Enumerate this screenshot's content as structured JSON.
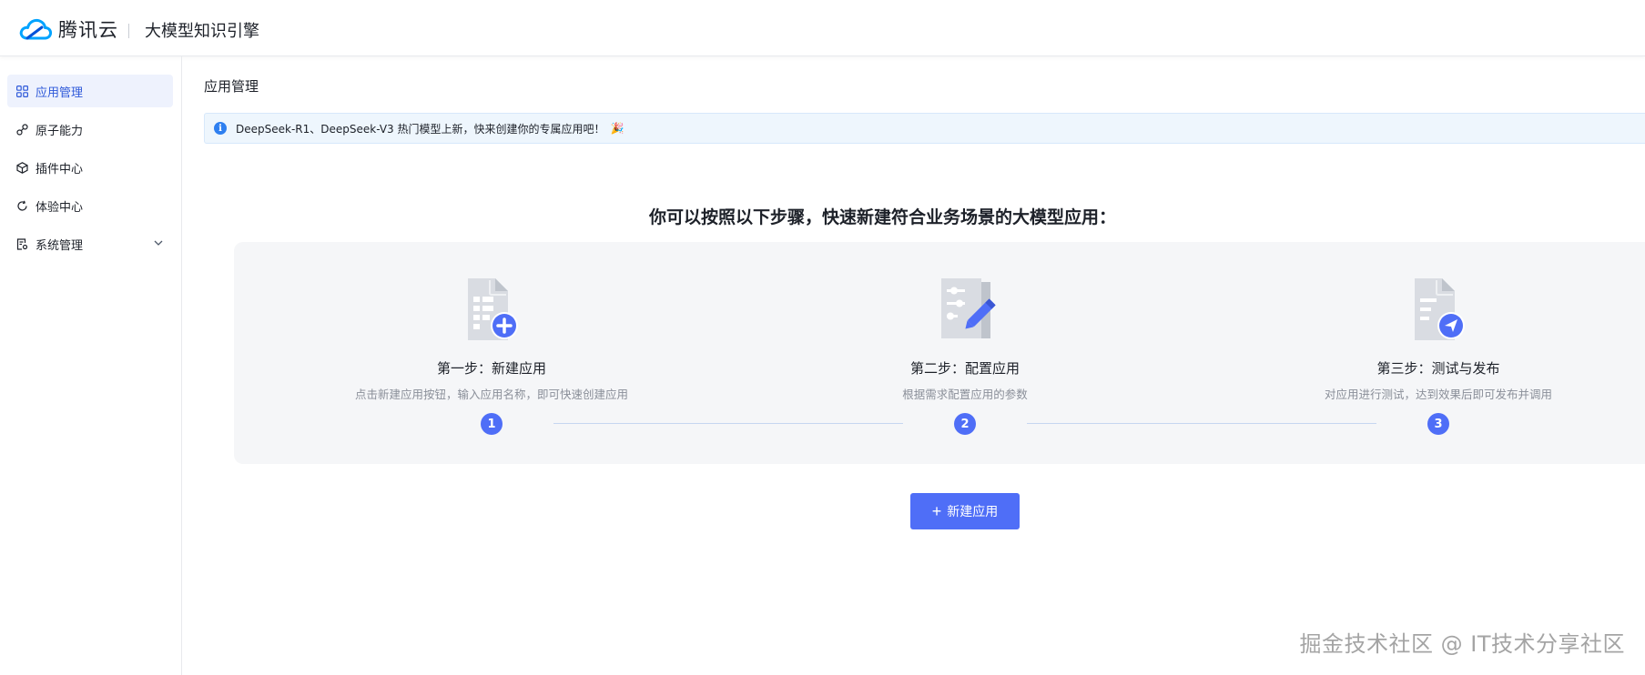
{
  "header": {
    "brand_name": "腾讯云",
    "product_name": "大模型知识引擎",
    "brand_color": "#0052d9"
  },
  "sidebar": {
    "items": [
      {
        "label": "应用管理",
        "icon": "grid-icon",
        "active": true
      },
      {
        "label": "原子能力",
        "icon": "link-icon",
        "active": false
      },
      {
        "label": "插件中心",
        "icon": "cube-icon",
        "active": false
      },
      {
        "label": "体验中心",
        "icon": "refresh-icon",
        "active": false
      },
      {
        "label": "系统管理",
        "icon": "settings-doc-icon",
        "active": false,
        "expandable": true
      }
    ]
  },
  "main": {
    "page_title": "应用管理",
    "notice": {
      "text": "DeepSeek-R1、DeepSeek-V3 热门模型上新，快来创建你的专属应用吧！",
      "emoji": "🎉"
    },
    "steps_heading": "你可以按照以下步骤，快速新建符合业务场景的大模型应用：",
    "steps": [
      {
        "number": "1",
        "title": "第一步：新建应用",
        "description": "点击新建应用按钮，输入应用名称，即可快速创建应用",
        "icon": "doc-add-icon"
      },
      {
        "number": "2",
        "title": "第二步：配置应用",
        "description": "根据需求配置应用的参数",
        "icon": "doc-edit-icon"
      },
      {
        "number": "3",
        "title": "第三步：测试与发布",
        "description": "对应用进行测试，达到效果后即可发布并调用",
        "icon": "doc-send-icon"
      }
    ],
    "new_app_button": "新建应用",
    "accent_color": "#4f6ef7"
  },
  "watermark": "掘金技术社区 @ IT技术分享社区"
}
